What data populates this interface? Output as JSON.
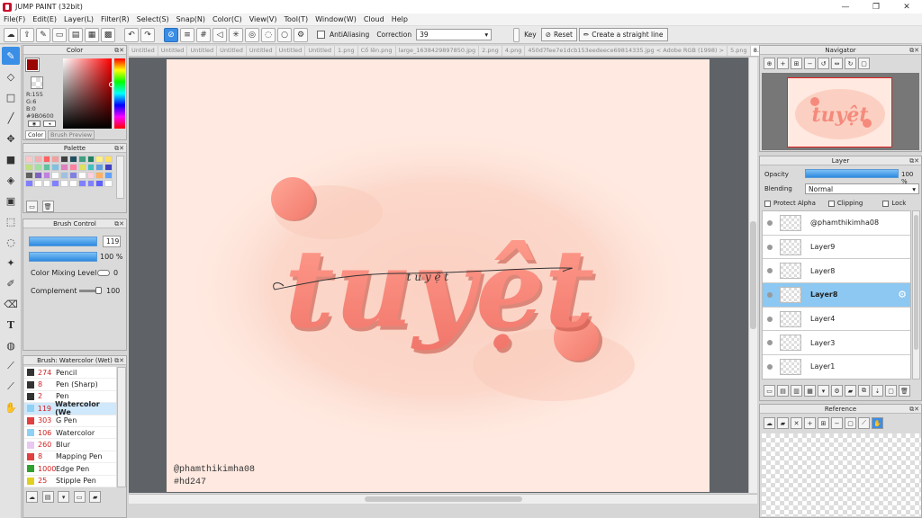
{
  "app": {
    "title": "JUMP PAINT (32bit)"
  },
  "menu": [
    "File(F)",
    "Edit(E)",
    "Layer(L)",
    "Filter(R)",
    "Select(S)",
    "Snap(N)",
    "Color(C)",
    "View(V)",
    "Tool(T)",
    "Window(W)",
    "Cloud",
    "Help"
  ],
  "toolbar": {
    "antialias_label": "AntiAliasing",
    "correction_label": "Correction",
    "correction_value": "39",
    "key_label": "Key",
    "reset_label": "Reset",
    "straight_line_label": "Create a straight line"
  },
  "tabs": [
    "Untitled",
    "Untitled",
    "Untitled",
    "Untitled",
    "Untitled",
    "Untitled",
    "Untitled",
    "1.png",
    "Cố lên.png",
    "large_1638429897850.jpg",
    "2.png",
    "4.png",
    "450d7fee7e1dcb153eedeece69814335.jpg < Adobe RGB (1998) >",
    "5.png",
    "8.png"
  ],
  "color_panel": {
    "title": "Color",
    "r": "R:155",
    "g": "G:6",
    "b": "B:0",
    "hex": "#9B0600",
    "tab_color": "Color",
    "tab_brush_preview": "Brush Preview",
    "primary": "#9B0600"
  },
  "palette_panel": {
    "title": "Palette",
    "swatches": [
      "#f8c8c8",
      "#f4b0b0",
      "#ff6060",
      "#f0a0a0",
      "#404040",
      "#205060",
      "#40a080",
      "#208060",
      "#fff080",
      "#ffe060",
      "#c0e080",
      "#a0e0a0",
      "#60c0a0",
      "#80c0e0",
      "#e080c0",
      "#ff80a0",
      "#e0e060",
      "#40c0c0",
      "#60a0e0",
      "#4040c0",
      "#606060",
      "#8060c0",
      "#c080e0",
      "#ffffff",
      "#a0c0e0",
      "#8080e0",
      "#ffffff",
      "#ffd0e0",
      "#ffb060",
      "#60a0ff",
      "#8080ff",
      "#ffffff",
      "#ffffff",
      "#8080ff",
      "#ffffff",
      "#ffffff",
      "#8080ff",
      "#8080ff",
      "#6060ff",
      "#ffffff"
    ]
  },
  "brush_control": {
    "title": "Brush Control",
    "size_value": "119",
    "opacity_value": "100 %",
    "mixing_label": "Color Mixing Level",
    "mixing_value": "0",
    "complement_label": "Complement",
    "complement_value": "100"
  },
  "brush_list": {
    "title": "Brush: Watercolor (Wet)",
    "items": [
      {
        "num": "274",
        "name": "Pencil",
        "color": "#333333"
      },
      {
        "num": "8",
        "name": "Pen (Sharp)",
        "color": "#333333"
      },
      {
        "num": "2",
        "name": "Pen",
        "color": "#333333"
      },
      {
        "num": "119",
        "name": "Watercolor (We",
        "color": "#8fd0f5",
        "selected": true
      },
      {
        "num": "303",
        "name": "G Pen",
        "color": "#e04040"
      },
      {
        "num": "106",
        "name": "Watercolor",
        "color": "#8fd0f5"
      },
      {
        "num": "260",
        "name": "Blur",
        "color": "#e8c8f0"
      },
      {
        "num": "8",
        "name": "Mapping Pen",
        "color": "#e04040"
      },
      {
        "num": "1000",
        "name": "Edge Pen",
        "color": "#30a030"
      },
      {
        "num": "25",
        "name": "Stipple Pen",
        "color": "#e0d020"
      }
    ]
  },
  "canvas": {
    "title_text": "tuyệt",
    "script_text": "t u y ệ t",
    "watermark_1": "@phamthikimha08",
    "watermark_2": "#hd247",
    "bg": "#ffe8df"
  },
  "navigator": {
    "title": "Navigator"
  },
  "layer_panel": {
    "title": "Layer",
    "opacity_label": "Opacity",
    "opacity_value": "100 %",
    "blending_label": "Blending",
    "blending_value": "Normal",
    "protect_alpha_label": "Protect Alpha",
    "clipping_label": "Clipping",
    "lock_label": "Lock",
    "layers": [
      {
        "name": "@phamthikimha08"
      },
      {
        "name": "Layer9"
      },
      {
        "name": "Layer8"
      },
      {
        "name": "Layer8",
        "selected": true
      },
      {
        "name": "Layer4"
      },
      {
        "name": "Layer3"
      },
      {
        "name": "Layer1"
      }
    ]
  },
  "reference_panel": {
    "title": "Reference"
  }
}
